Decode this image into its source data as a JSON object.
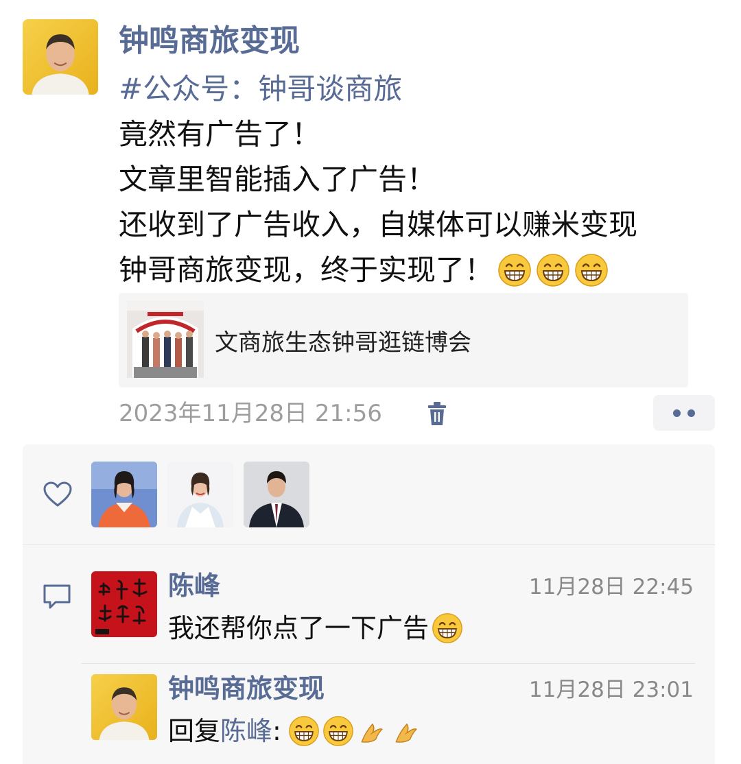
{
  "post": {
    "author": "钟鸣商旅变现",
    "hashtag": "#公众号：钟哥谈商旅",
    "lines": [
      "竟然有广告了！",
      "文章里智能插入了广告！",
      "还收到了广告收入，自媒体可以赚米变现",
      "钟哥商旅变现，终于实现了！"
    ],
    "link_title": "文商旅生态钟哥逛链博会",
    "timestamp": "2023年11月28日 21:56"
  },
  "likes": {
    "icon": "heart-icon",
    "count_shown": 3
  },
  "comments": [
    {
      "author": "陈峰",
      "time": "11月28日 22:45",
      "text": "我还帮你点了一下广告"
    },
    {
      "author": "钟鸣商旅变现",
      "time": "11月28日 23:01",
      "reply_prefix": "回复",
      "reply_to": "陈峰",
      "reply_colon": ":"
    }
  ],
  "colors": {
    "link_blue": "#576b95",
    "timestamp_gray": "#9d9d9d",
    "panel_bg": "#f7f7f7"
  }
}
